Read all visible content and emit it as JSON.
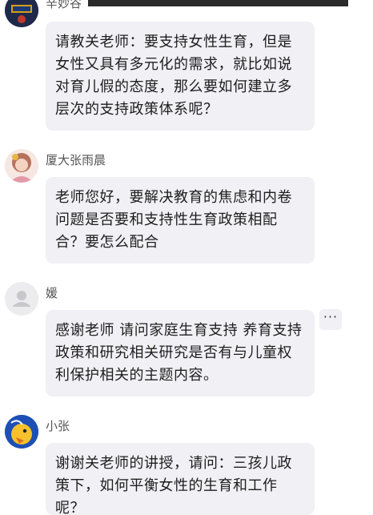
{
  "messages": [
    {
      "name": "辛妙谷",
      "text": "请教关老师：要支持女性生育，但是女性又具有多元化的需求，就比如说对育儿假的态度，那么要如何建立多层次的支持政策体系呢？"
    },
    {
      "name": "厦大张雨晨",
      "text": "老师您好，要解决教育的焦虑和内卷问题是否要和支持性生育政策相配合？要怎么配合"
    },
    {
      "name": "媛",
      "text": "感谢老师   请问家庭生育支持 养育支持政策和研究相关研究是否有与儿童权利保护相关的主题内容。"
    },
    {
      "name": "小张",
      "text": "谢谢关老师的讲授，请问：三孩儿政策下，如何平衡女性的生育和工作呢？"
    }
  ],
  "more_button": "···",
  "colors": {
    "bubble_bg": "#f0f0f5",
    "name_text": "#555555",
    "message_text": "#1e1e1e",
    "top_bar": "#2b2b2b"
  }
}
